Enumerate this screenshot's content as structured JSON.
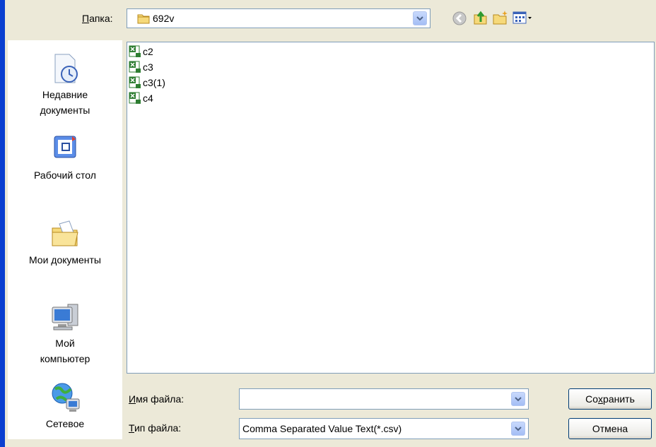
{
  "header": {
    "folder_label_mnemonic": "П",
    "folder_label_rest": "апка:",
    "folder_value": "692v"
  },
  "places": [
    {
      "label": "Недавние\nдокументы",
      "icon": "recent-documents-icon"
    },
    {
      "label": "Рабочий стол",
      "icon": "desktop-icon"
    },
    {
      "label": "Мои документы",
      "icon": "my-documents-icon"
    },
    {
      "label": "Мой\nкомпьютер",
      "icon": "my-computer-icon"
    },
    {
      "label": "Сетевое",
      "icon": "network-icon"
    }
  ],
  "files": [
    {
      "name": "c2"
    },
    {
      "name": "c3"
    },
    {
      "name": "c3(1)"
    },
    {
      "name": "c4"
    }
  ],
  "filename": {
    "label_mnemonic": "И",
    "label_rest": "мя файла:",
    "value": ""
  },
  "filetype": {
    "label_mnemonic": "Т",
    "label_rest": "ип файла:",
    "value": "Comma Separated Value Text(*.csv)"
  },
  "buttons": {
    "save_pre": "Со",
    "save_mnemonic": "х",
    "save_post": "ранить",
    "cancel": "Отмена"
  }
}
